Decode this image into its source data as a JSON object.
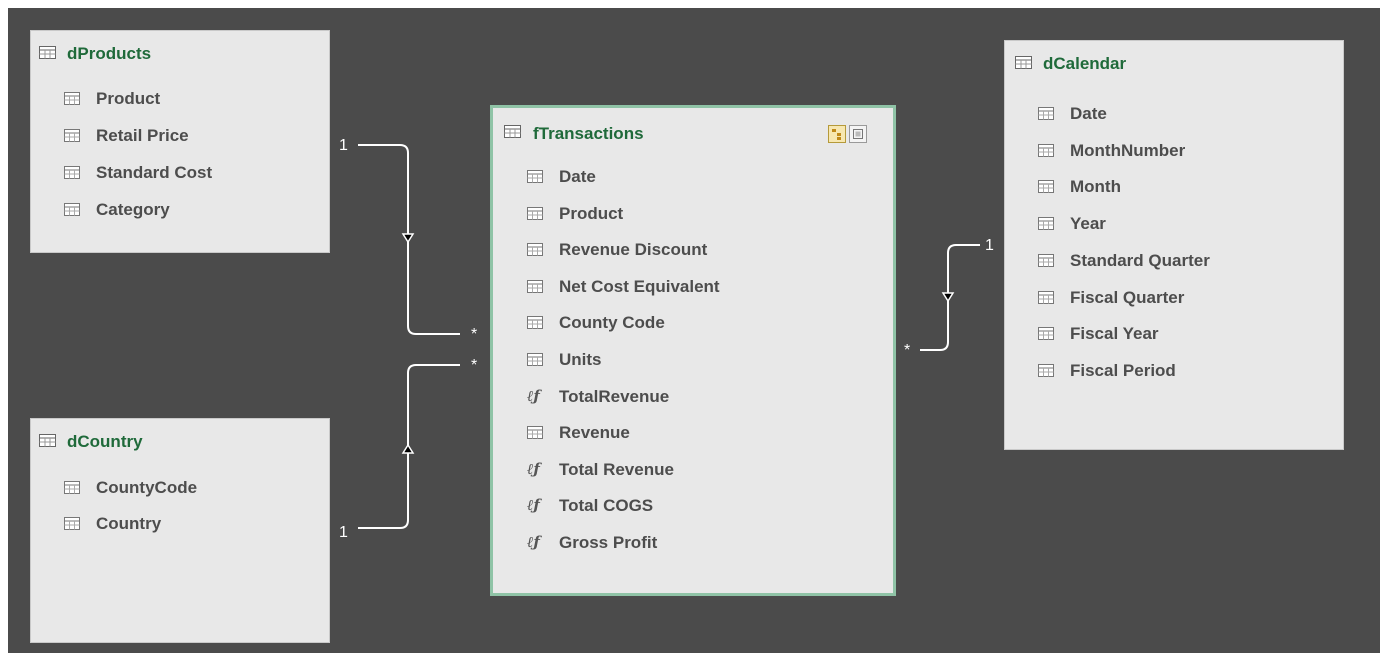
{
  "tables": {
    "dProducts": {
      "title": "dProducts",
      "fields": [
        "Product",
        "Retail Price",
        "Standard Cost",
        "Category"
      ]
    },
    "dCountry": {
      "title": "dCountry",
      "fields": [
        "CountyCode",
        "Country"
      ]
    },
    "fTransactions": {
      "title": "fTransactions",
      "fields": [
        {
          "name": "Date",
          "kind": "column"
        },
        {
          "name": "Product",
          "kind": "column"
        },
        {
          "name": "Revenue Discount",
          "kind": "column"
        },
        {
          "name": "Net Cost Equivalent",
          "kind": "column"
        },
        {
          "name": "County Code",
          "kind": "column"
        },
        {
          "name": "Units",
          "kind": "column"
        },
        {
          "name": "TotalRevenue",
          "kind": "measure"
        },
        {
          "name": "Revenue",
          "kind": "column"
        },
        {
          "name": "Total Revenue",
          "kind": "measure"
        },
        {
          "name": "Total COGS",
          "kind": "measure"
        },
        {
          "name": "Gross Profit",
          "kind": "measure"
        }
      ]
    },
    "dCalendar": {
      "title": "dCalendar",
      "fields": [
        "Date",
        "MonthNumber",
        "Month",
        "Year",
        "Standard Quarter",
        "Fiscal Quarter",
        "Fiscal Year",
        "Fiscal Period"
      ]
    }
  },
  "relationships": {
    "products": {
      "one": "1",
      "many": "*"
    },
    "country": {
      "one": "1",
      "many": "*"
    },
    "calendar": {
      "one": "1",
      "many": "*"
    }
  },
  "icons": {
    "table": "table-icon",
    "column": "column-icon",
    "measure": "measure-icon",
    "filter_arrow": "filter-direction-arrow"
  },
  "colors": {
    "canvas": "#4b4b4b",
    "table_bg": "#e8e8e8",
    "title": "#1f6a3a",
    "selected_border": "#8fc3a6"
  }
}
